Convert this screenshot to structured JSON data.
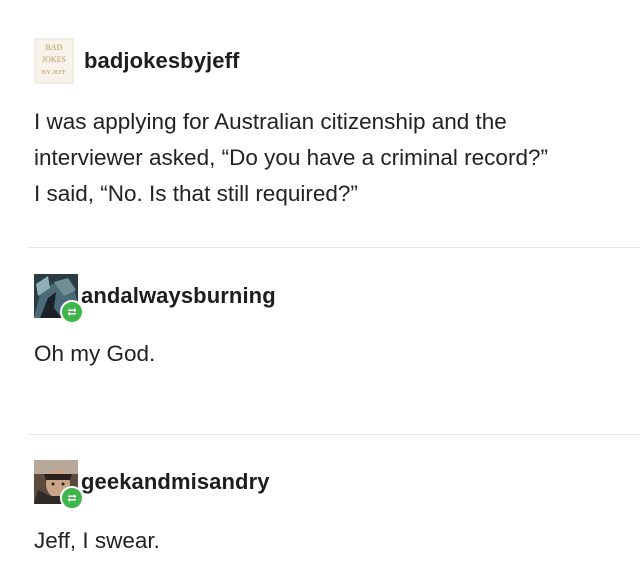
{
  "posts": [
    {
      "username": "badjokesbyjeff",
      "avatar": {
        "type": "logo",
        "logo_lines": [
          "BAD",
          "JOKES",
          "BY JEFF"
        ]
      },
      "lines": [
        "I was applying for Australian citizenship and the",
        "interviewer asked, “Do you have a criminal record?”",
        "I said, “No. Is that still required?”"
      ]
    },
    {
      "username": "andalwaysburning",
      "avatar": {
        "type": "photo",
        "badge": "reblog-icon"
      },
      "lines": [
        "Oh my God."
      ]
    },
    {
      "username": "geekandmisandry",
      "avatar": {
        "type": "photo",
        "badge": "reblog-icon"
      },
      "lines": [
        "Jeff, I swear."
      ]
    }
  ],
  "colors": {
    "badge_green": "#3fb54a",
    "divider": "#e6e6e6",
    "text": "#222222"
  }
}
